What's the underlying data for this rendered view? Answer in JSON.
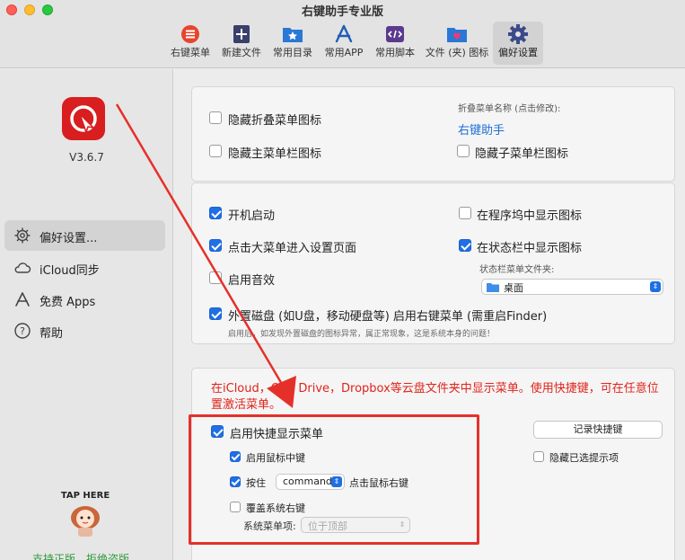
{
  "window": {
    "title": "右键助手专业版"
  },
  "toolbar": {
    "items": [
      {
        "label": "右键菜单",
        "icon": "right-click-menu-icon"
      },
      {
        "label": "新建文件",
        "icon": "new-file-icon"
      },
      {
        "label": "常用目录",
        "icon": "folder-star-icon"
      },
      {
        "label": "常用APP",
        "icon": "app-store-icon"
      },
      {
        "label": "常用脚本",
        "icon": "script-icon"
      },
      {
        "label": "文件 (夹) 图标",
        "icon": "folder-heart-icon"
      },
      {
        "label": "偏好设置",
        "icon": "gear-icon"
      }
    ],
    "active_index": 6
  },
  "sidebar": {
    "version": "V3.6.7",
    "items": [
      {
        "label": "偏好设置...",
        "icon": "gear-icon"
      },
      {
        "label": "iCloud同步",
        "icon": "cloud-icon"
      },
      {
        "label": "免费 Apps",
        "icon": "app-store-icon"
      },
      {
        "label": "帮助",
        "icon": "question-icon"
      }
    ],
    "mascot_text": "TAP HERE",
    "support_text": "支持正版，拒绝盗版"
  },
  "panel1": {
    "hide_fold_icon": {
      "label": "隐藏折叠菜单图标",
      "checked": false
    },
    "hide_main_bar_icon": {
      "label": "隐藏主菜单栏图标",
      "checked": false
    },
    "fold_name_caption": "折叠菜单名称 (点击修改):",
    "fold_name_value": "右键助手",
    "hide_sub_bar_icon": {
      "label": "隐藏子菜单栏图标",
      "checked": false
    }
  },
  "panel2": {
    "launch_at_login": {
      "label": "开机启动",
      "checked": true
    },
    "show_in_dock": {
      "label": "在程序坞中显示图标",
      "checked": false
    },
    "click_menu_settings": {
      "label": "点击大菜单进入设置页面",
      "checked": true
    },
    "show_in_statusbar": {
      "label": "在状态栏中显示图标",
      "checked": true
    },
    "enable_sound": {
      "label": "启用音效",
      "checked": false
    },
    "statusbar_folder_caption": "状态栏菜单文件夹:",
    "statusbar_folder_value": "桌面",
    "external_disk": {
      "label": "外置磁盘 (如U盘，移动硬盘等) 启用右键菜单 (需重启Finder)",
      "checked": true
    },
    "external_disk_hint": "启用后，如发现外置磁盘的图标异常，属正常现象，这是系统本身的问题！"
  },
  "panel3": {
    "warning": "在iCloud，One Drive，Dropbox等云盘文件夹中显示菜单。使用快捷键，可在任意位置激活菜单。",
    "enable_shortcut": {
      "label": "启用快捷显示菜单",
      "checked": true
    },
    "record_shortcut_button": "记录快捷键",
    "enable_middle_click": {
      "label": "启用鼠标中键",
      "checked": true
    },
    "hide_selected_hint": {
      "label": "隐藏已选提示项",
      "checked": false
    },
    "hold_key": {
      "label": "按住",
      "checked": true
    },
    "hold_key_value": "command",
    "hold_key_suffix": "点击鼠标右键",
    "override_system": {
      "label": "覆盖系统右键",
      "checked": false
    },
    "system_menu_caption": "系统菜单项:",
    "system_menu_value": "位于顶部"
  },
  "colors": {
    "accent": "#1f6fe5",
    "warning": "#e0241b",
    "annotation": "#e5302a",
    "support_green": "#2f9a3a",
    "logo_red": "#d81e1e"
  }
}
